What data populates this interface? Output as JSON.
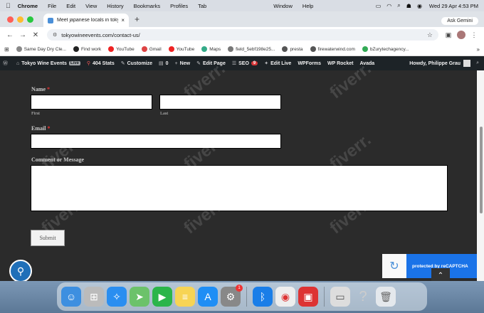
{
  "menubar": {
    "app": "Chrome",
    "items": [
      "File",
      "Edit",
      "View",
      "History",
      "Bookmarks",
      "Profiles",
      "Tab",
      "Window",
      "Help"
    ],
    "datetime": "Wed 29 Apr  4:53 PM"
  },
  "tab": {
    "title": "Meet japanese locals in tokyo",
    "close": "×",
    "new_tab": "+",
    "ask_gemini": "Ask Gemini"
  },
  "toolbar": {
    "url": "tokyowineevents.com/contact-us/"
  },
  "bookmarks": [
    {
      "label": "Same Day Dry Cle...",
      "color": "#888"
    },
    {
      "label": "Find work",
      "color": "#222"
    },
    {
      "label": "YouTube",
      "color": "#e22"
    },
    {
      "label": "Gmail",
      "color": "#d44"
    },
    {
      "label": "YouTube",
      "color": "#e22"
    },
    {
      "label": "Maps",
      "color": "#3a8"
    },
    {
      "label": "field_5ebf198e25...",
      "color": "#777"
    },
    {
      "label": "presta",
      "color": "#555"
    },
    {
      "label": "firewaterwind.com",
      "color": "#555"
    },
    {
      "label": "bZurytechagency...",
      "color": "#3a5"
    }
  ],
  "wpbar": {
    "site": "Tokyo Wine Events",
    "live_tag": "Live",
    "stats": "404 Stats",
    "customize": "Customize",
    "comments": "0",
    "new": "New",
    "edit_page": "Edit Page",
    "seo": "SEO",
    "seo_count": "9",
    "edit_live": "Edit Live",
    "wpforms": "WPForms",
    "wprocket": "WP Rocket",
    "avada": "Avada",
    "howdy": "Howdy, Philippe Grau"
  },
  "form": {
    "name_label": "Name",
    "required_mark": "*",
    "first_label": "First",
    "last_label": "Last",
    "email_label": "Email",
    "comment_label": "Comment or Message",
    "submit_label": "Submit"
  },
  "recaptcha": {
    "text": "protected by reCAPTCHA"
  },
  "watermark": "fiverr.",
  "dock": {
    "badge": "1"
  }
}
